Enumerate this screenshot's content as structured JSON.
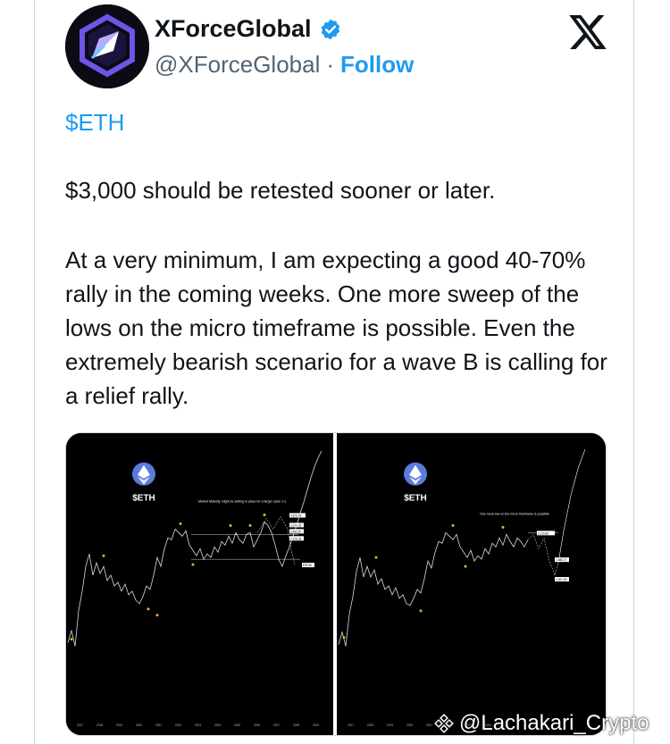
{
  "tweet": {
    "author": {
      "display_name": "XForceGlobal",
      "handle": "@XForceGlobal",
      "separator": "·",
      "follow_label": "Follow",
      "verified": true
    },
    "cashtag": "$ETH",
    "paragraphs": [
      "$3,000 should be retested sooner or later.",
      "At a very minimum, I am expecting a good 40-70% rally in the coming weeks. One more sweep of the lows on the micro timeframe is possible. Even the extremely bearish scenario for a wave B is calling for a relief rally."
    ]
  },
  "media": {
    "left_chart": {
      "ticker": "$ETH",
      "note": "Market Maturity might be setting in place for a larger cycle 1-2.",
      "x_ticks": [
        "2017",
        "2018",
        "2019",
        "2020",
        "2021",
        "2022",
        "2023",
        "2024",
        "2025",
        "2026",
        "2027",
        "2028",
        "2029"
      ],
      "labels": [
        "4,579.95",
        "3,970.35",
        "3,460.87",
        "2,578.38",
        "$78.86"
      ]
    },
    "right_chart": {
      "ticker": "$ETH",
      "note": "One more low on the micro timeframe is possible",
      "x_ticks": [
        "2017",
        "2018",
        "2019",
        "2020",
        "2021",
        "2022",
        "2023",
        "2024"
      ],
      "labels": [
        "3,115.82",
        "1,586.27",
        "1,001.09"
      ]
    }
  },
  "watermark": {
    "text": "@Lachakari_Crypto",
    "icon": "binance-diamond-icon"
  },
  "colors": {
    "accent": "#1d9bf0",
    "text": "#0f1419",
    "muted": "#536471",
    "chart_bg": "#000000",
    "eth_blue": "#5b7bdb"
  }
}
